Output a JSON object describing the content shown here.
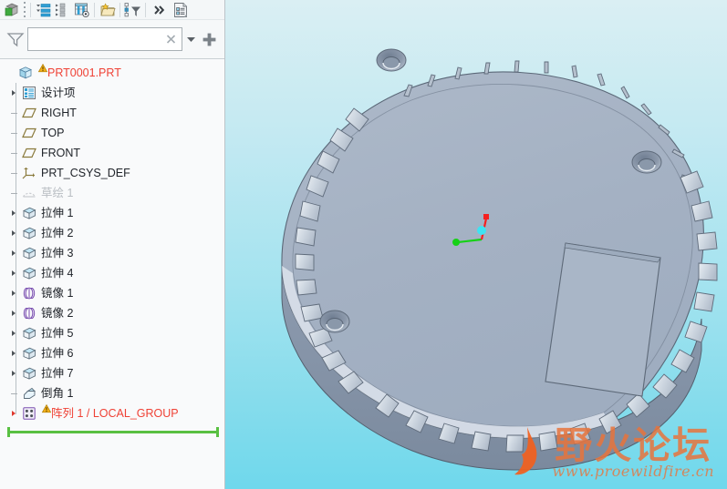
{
  "app": {
    "model_name": "PRT0001.PRT"
  },
  "toolbar": {
    "items": [
      {
        "name": "show-model-tree-button",
        "icon": "cube-green-icon",
        "tooltip": "Model Tree"
      },
      {
        "name": "tree-handle",
        "icon": "drag-dots-icon",
        "tooltip": "Drag handle"
      },
      {
        "name": "tree-display-button",
        "icon": "list-blue-icon",
        "tooltip": "Tree Display"
      },
      {
        "name": "expand-collapse-button",
        "icon": "tree-nodes-icon",
        "tooltip": "Expand / Collapse"
      },
      {
        "name": "tree-columns-button",
        "icon": "table-columns-icon",
        "tooltip": "Tree Columns"
      },
      {
        "name": "layers-button",
        "icon": "folder-star-icon",
        "tooltip": "Layers"
      },
      {
        "name": "tree-filters-button",
        "icon": "filter-nodes-icon",
        "tooltip": "Tree Filters"
      },
      {
        "name": "overflow-button",
        "icon": "chevron-double-right-icon",
        "tooltip": "More"
      },
      {
        "name": "tree-settings-button",
        "icon": "document-list-icon",
        "tooltip": "Settings"
      }
    ]
  },
  "filter": {
    "icon": "funnel-icon",
    "value": "",
    "placeholder": "",
    "clear_icon": "close-x-icon",
    "dropdown_icon": "caret-down-icon",
    "add_icon": "plus-icon"
  },
  "tree": {
    "items": [
      {
        "label": "PRT0001.PRT",
        "icon": "part-cube-icon",
        "indent": 0,
        "expander": "none",
        "state": "error",
        "warning": true
      },
      {
        "label": "设计项",
        "icon": "design-items-icon",
        "indent": 1,
        "expander": "collapsed",
        "state": "normal",
        "warning": false
      },
      {
        "label": "RIGHT",
        "icon": "datum-plane-icon",
        "indent": 1,
        "expander": "leaf",
        "state": "normal",
        "warning": false
      },
      {
        "label": "TOP",
        "icon": "datum-plane-icon",
        "indent": 1,
        "expander": "leaf",
        "state": "normal",
        "warning": false
      },
      {
        "label": "FRONT",
        "icon": "datum-plane-icon",
        "indent": 1,
        "expander": "leaf",
        "state": "normal",
        "warning": false
      },
      {
        "label": "PRT_CSYS_DEF",
        "icon": "coord-system-icon",
        "indent": 1,
        "expander": "leaf",
        "state": "normal",
        "warning": false
      },
      {
        "label": "草绘 1",
        "icon": "sketch-icon",
        "indent": 1,
        "expander": "leaf",
        "state": "suppressed",
        "warning": false
      },
      {
        "label": "拉伸 1",
        "icon": "extrude-icon",
        "indent": 1,
        "expander": "collapsed",
        "state": "normal",
        "warning": false
      },
      {
        "label": "拉伸 2",
        "icon": "extrude-icon",
        "indent": 1,
        "expander": "collapsed",
        "state": "normal",
        "warning": false
      },
      {
        "label": "拉伸 3",
        "icon": "extrude-icon",
        "indent": 1,
        "expander": "collapsed",
        "state": "normal",
        "warning": false
      },
      {
        "label": "拉伸 4",
        "icon": "extrude-icon",
        "indent": 1,
        "expander": "collapsed",
        "state": "normal",
        "warning": false
      },
      {
        "label": "镜像 1",
        "icon": "mirror-icon",
        "indent": 1,
        "expander": "collapsed",
        "state": "normal",
        "warning": false
      },
      {
        "label": "镜像 2",
        "icon": "mirror-icon",
        "indent": 1,
        "expander": "collapsed",
        "state": "normal",
        "warning": false
      },
      {
        "label": "拉伸 5",
        "icon": "extrude-icon",
        "indent": 1,
        "expander": "collapsed",
        "state": "normal",
        "warning": false
      },
      {
        "label": "拉伸 6",
        "icon": "extrude-icon",
        "indent": 1,
        "expander": "collapsed",
        "state": "normal",
        "warning": false
      },
      {
        "label": "拉伸 7",
        "icon": "extrude-icon",
        "indent": 1,
        "expander": "collapsed",
        "state": "normal",
        "warning": false
      },
      {
        "label": "倒角 1",
        "icon": "chamfer-icon",
        "indent": 1,
        "expander": "leaf",
        "state": "normal",
        "warning": false
      },
      {
        "label": "阵列 1 / LOCAL_GROUP",
        "icon": "pattern-icon",
        "indent": 1,
        "expander": "expandable-red",
        "state": "error",
        "warning": true
      }
    ],
    "insert_here": {
      "name": "insert-here-bar",
      "color": "#59c042"
    }
  },
  "viewport": {
    "background_top": "#daeff3",
    "background_bottom": "#6fd8ec",
    "model_color": "#a5b2c4",
    "csys": {
      "name": "coordinate-triad",
      "x_axis_color": "#22cc22",
      "y_axis_color": "#ee2222",
      "z_axis_color": "#44e0ee"
    },
    "watermark": {
      "text": "野火论坛",
      "url": "www.proewildfire.cn",
      "color": "#e8743c"
    }
  }
}
